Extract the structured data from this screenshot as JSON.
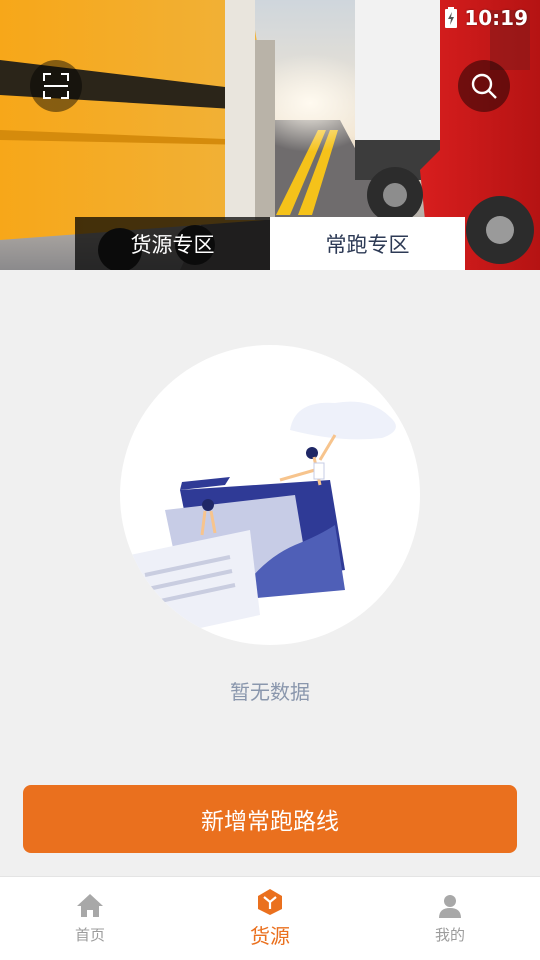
{
  "status_bar": {
    "time": "10:19"
  },
  "header": {
    "tabs": [
      {
        "label": "货源专区",
        "active": false
      },
      {
        "label": "常跑专区",
        "active": true
      }
    ]
  },
  "empty_state": {
    "message": "暂无数据"
  },
  "actions": {
    "add_route_label": "新增常跑路线"
  },
  "bottom_nav": {
    "items": [
      {
        "label": "首页",
        "icon": "home-icon",
        "active": false
      },
      {
        "label": "货源",
        "icon": "cube-icon",
        "active": true
      },
      {
        "label": "我的",
        "icon": "user-icon",
        "active": false
      }
    ]
  },
  "colors": {
    "accent": "#ea701e",
    "background": "#f0f0f0",
    "muted_text": "#8a97ad"
  }
}
